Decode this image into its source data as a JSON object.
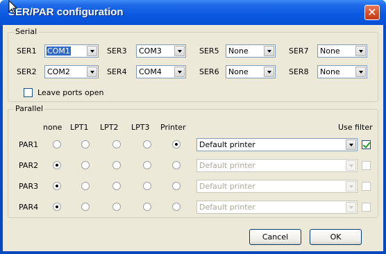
{
  "window": {
    "title": "SER/PAR configuration",
    "close_glyph": "✕"
  },
  "serial": {
    "group_label": "Serial",
    "ports": [
      {
        "label": "SER1",
        "value": "COM1"
      },
      {
        "label": "SER3",
        "value": "COM3"
      },
      {
        "label": "SER5",
        "value": "None"
      },
      {
        "label": "SER7",
        "value": "None"
      },
      {
        "label": "SER2",
        "value": "COM2"
      },
      {
        "label": "SER4",
        "value": "COM4"
      },
      {
        "label": "SER6",
        "value": "None"
      },
      {
        "label": "SER8",
        "value": "None"
      }
    ],
    "leave_open_label": "Leave ports open",
    "leave_open_checked": false
  },
  "parallel": {
    "group_label": "Parallel",
    "columns": [
      "none",
      "LPT1",
      "LPT2",
      "LPT3",
      "Printer"
    ],
    "use_filter_label": "Use filter",
    "rows": [
      {
        "label": "PAR1",
        "selected": "Printer",
        "printer": "Default printer",
        "enabled": true,
        "filter": true
      },
      {
        "label": "PAR2",
        "selected": "none",
        "printer": "Default printer",
        "enabled": false,
        "filter": false
      },
      {
        "label": "PAR3",
        "selected": "none",
        "printer": "Default printer",
        "enabled": false,
        "filter": false
      },
      {
        "label": "PAR4",
        "selected": "none",
        "printer": "Default printer",
        "enabled": false,
        "filter": false
      }
    ]
  },
  "buttons": {
    "cancel": "Cancel",
    "ok": "OK"
  }
}
